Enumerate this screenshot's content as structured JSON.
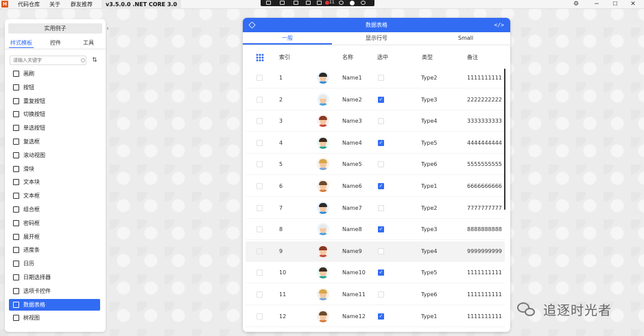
{
  "app": {
    "logo_letter": "H",
    "menu": [
      "代码仓库",
      "关于",
      "群友推荐"
    ],
    "version": "v3.5.0.0 .NET CORE 3.0",
    "tray_badge": "11"
  },
  "side": {
    "title": "实用例子",
    "tabs": [
      "样式模板",
      "控件",
      "工具"
    ],
    "search_placeholder": "请输入关键字",
    "items": [
      {
        "label": "画刷",
        "icon": "brush-icon"
      },
      {
        "label": "按钮",
        "icon": "button-icon"
      },
      {
        "label": "重复按钮",
        "icon": "repeat-button-icon"
      },
      {
        "label": "切换按钮",
        "icon": "toggle-button-icon"
      },
      {
        "label": "单选按钮",
        "icon": "radio-button-icon"
      },
      {
        "label": "复选框",
        "icon": "checkbox-icon"
      },
      {
        "label": "滚动视图",
        "icon": "scroll-view-icon"
      },
      {
        "label": "滑块",
        "icon": "slider-icon"
      },
      {
        "label": "文本块",
        "icon": "text-block-icon"
      },
      {
        "label": "文本框",
        "icon": "textbox-icon"
      },
      {
        "label": "组合框",
        "icon": "combobox-icon"
      },
      {
        "label": "密码框",
        "icon": "password-box-icon"
      },
      {
        "label": "展开框",
        "icon": "expander-icon"
      },
      {
        "label": "进度条",
        "icon": "progress-bar-icon"
      },
      {
        "label": "日历",
        "icon": "calendar-icon"
      },
      {
        "label": "日期选择器",
        "icon": "date-picker-icon"
      },
      {
        "label": "选项卡控件",
        "icon": "tab-control-icon"
      },
      {
        "label": "数据表格",
        "icon": "data-grid-icon",
        "active": true
      },
      {
        "label": "树视图",
        "icon": "tree-view-icon"
      }
    ]
  },
  "grid": {
    "title": "数据表格",
    "code_label": "</>",
    "tabs": [
      "一般",
      "显示行号",
      "Small"
    ],
    "headers": [
      "索引",
      "名称",
      "选中",
      "类型",
      "备注"
    ],
    "rows": [
      {
        "index": "1",
        "name": "Name1",
        "checked": false,
        "type": "Type2",
        "remark": "1111111111"
      },
      {
        "index": "2",
        "name": "Name2",
        "checked": true,
        "type": "Type3",
        "remark": "2222222222"
      },
      {
        "index": "3",
        "name": "Name3",
        "checked": false,
        "type": "Type4",
        "remark": "3333333333"
      },
      {
        "index": "4",
        "name": "Name4",
        "checked": true,
        "type": "Type5",
        "remark": "4444444444"
      },
      {
        "index": "5",
        "name": "Name5",
        "checked": false,
        "type": "Type6",
        "remark": "5555555555"
      },
      {
        "index": "6",
        "name": "Name6",
        "checked": true,
        "type": "Type1",
        "remark": "6666666666"
      },
      {
        "index": "7",
        "name": "Name7",
        "checked": false,
        "type": "Type2",
        "remark": "7777777777"
      },
      {
        "index": "8",
        "name": "Name8",
        "checked": true,
        "type": "Type3",
        "remark": "8888888888"
      },
      {
        "index": "9",
        "name": "Name9",
        "checked": false,
        "type": "Type4",
        "remark": "9999999999"
      },
      {
        "index": "10",
        "name": "Name10",
        "checked": true,
        "type": "Type5",
        "remark": "1111111111"
      },
      {
        "index": "11",
        "name": "Name11",
        "checked": false,
        "type": "Type6",
        "remark": "1111111111"
      },
      {
        "index": "12",
        "name": "Name12",
        "checked": true,
        "type": "Type1",
        "remark": "1111111111"
      }
    ]
  },
  "watermark": {
    "text": "追逐时光者"
  },
  "colors": {
    "accent": "#326cf3",
    "logo": "#e2591c"
  }
}
